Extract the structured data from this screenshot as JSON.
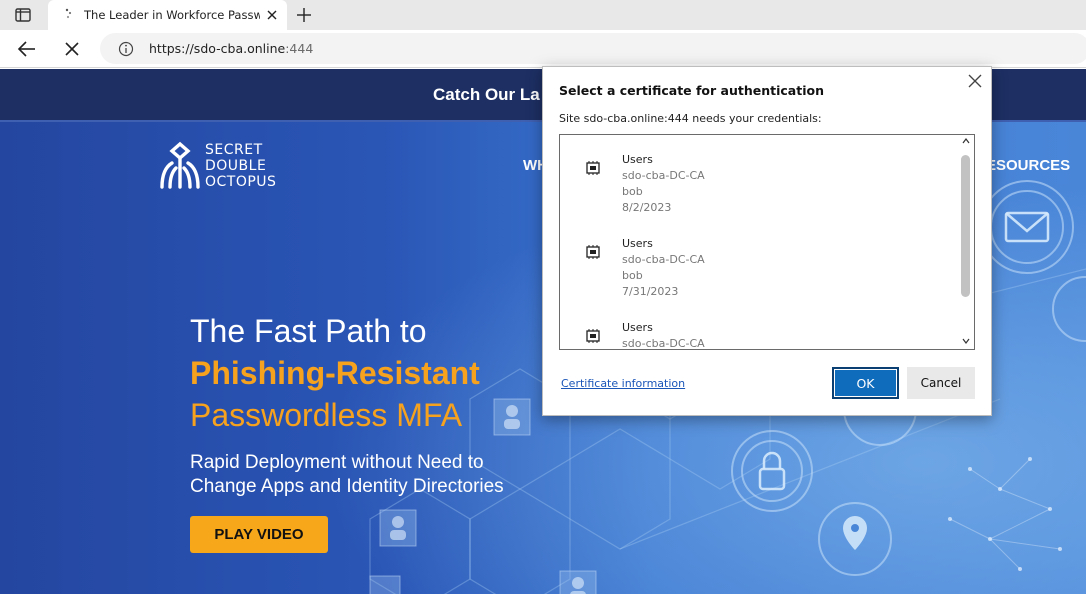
{
  "browser": {
    "tab": {
      "title": "The Leader in Workforce Passwordless MFA"
    },
    "address": {
      "url_main": "https://sdo-cba.online",
      "url_port": ":444"
    }
  },
  "site": {
    "banner_text": "Catch Our La",
    "logo_lines": [
      "SECRET",
      "DOUBLE",
      "OCTOPUS"
    ],
    "nav_peek": "WH",
    "nav_resources": "ESOURCES",
    "hero": {
      "line1": "The Fast Path to",
      "line2": "Phishing-Resistant",
      "line3": "Passwordless MFA"
    },
    "subtitle": {
      "line1": "Rapid Deployment without Need to",
      "line2": "Change Apps and Identity Directories"
    },
    "play_button": "PLAY VIDEO",
    "colors": {
      "banner": "#1d2f63",
      "accent": "#f6a21e"
    }
  },
  "dialog": {
    "title": "Select a certificate for authentication",
    "description": "Site sdo-cba.online:444 needs your credentials:",
    "certificates": [
      {
        "name": "Users",
        "issuer": "sdo-cba-DC-CA",
        "user": "bob",
        "date": "8/2/2023"
      },
      {
        "name": "Users",
        "issuer": "sdo-cba-DC-CA",
        "user": "bob",
        "date": "7/31/2023"
      },
      {
        "name": "Users",
        "issuer": "sdo-cba-DC-CA",
        "user": "",
        "date": ""
      }
    ],
    "cert_info_link": "Certificate information",
    "ok_label": "OK",
    "cancel_label": "Cancel"
  }
}
